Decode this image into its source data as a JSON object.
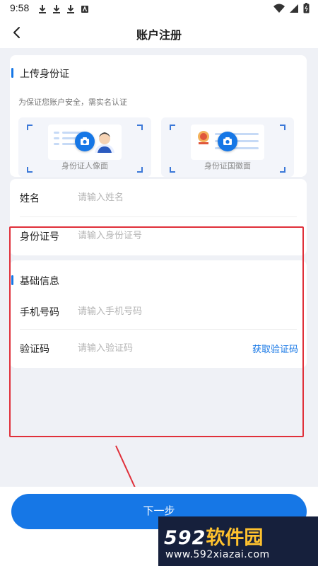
{
  "status_bar": {
    "time": "9:58"
  },
  "header": {
    "title": "账户注册"
  },
  "upload_section": {
    "title": "上传身份证",
    "hint": "为保证您账户安全，需实名认证",
    "front_label": "身份证人像面",
    "back_label": "身份证国徽面"
  },
  "identity_form": {
    "name_label": "姓名",
    "name_placeholder": "请输入姓名",
    "id_label": "身份证号",
    "id_placeholder": "请输入身份证号"
  },
  "basic_section": {
    "title": "基础信息",
    "phone_label": "手机号码",
    "phone_placeholder": "请输入手机号码",
    "code_label": "验证码",
    "code_placeholder": "请输入验证码",
    "get_code": "获取验证码"
  },
  "next_button": "下一步",
  "watermark": {
    "numbers": "592",
    "brand": "软件园",
    "url": "www.592xiazai.com"
  },
  "colors": {
    "accent": "#1677e6",
    "annotation_red": "#e0303a",
    "page_bg": "#eff1f6"
  }
}
